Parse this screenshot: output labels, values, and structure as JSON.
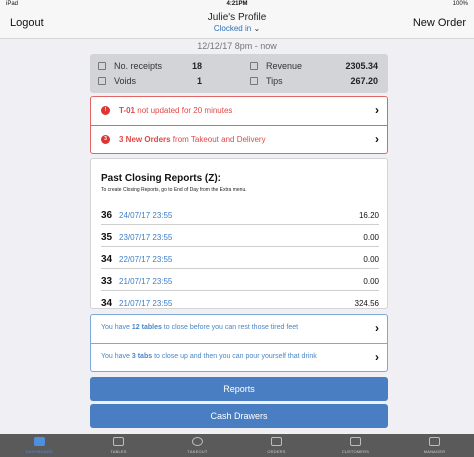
{
  "status_bar": {
    "carrier": "iPad",
    "time": "4:21PM",
    "battery": "100%"
  },
  "header": {
    "left_button": "Logout",
    "title": "Julie's Profile",
    "subtitle": "Clocked in",
    "right_button": "New Order"
  },
  "date_range": "12/12/17 8pm - now",
  "stats": {
    "receipts_label": "No. receipts",
    "receipts_value": "18",
    "voids_label": "Voids",
    "voids_value": "1",
    "revenue_label": "Revenue",
    "revenue_value": "2305.34",
    "tips_label": "Tips",
    "tips_value": "267.20"
  },
  "alerts": [
    {
      "badge": "!",
      "bold": "T-01",
      "text": " not updated for 20 minutes"
    },
    {
      "badge": "3",
      "bold": "3 New Orders",
      "text": " from Takeout and Delivery"
    }
  ],
  "past_reports": {
    "title": "Past Closing Reports (Z):",
    "subtitle": "To create Closing Reports, go to End of Day from the Extra menu.",
    "rows": [
      {
        "num": "36",
        "date": "24/07/17 23:55",
        "amount": "16.20"
      },
      {
        "num": "35",
        "date": "23/07/17 23:55",
        "amount": "0.00"
      },
      {
        "num": "34",
        "date": "22/07/17 23:55",
        "amount": "0.00"
      },
      {
        "num": "33",
        "date": "21/07/17 23:55",
        "amount": "0.00"
      },
      {
        "num": "34",
        "date": "21/07/17 23:55",
        "amount": "324.56"
      }
    ]
  },
  "tables_messages": [
    {
      "pre": "You have ",
      "bold": "12 tables",
      "post": " to close before you can rest those tired feet"
    },
    {
      "pre": "You have ",
      "bold": "3 tabs",
      "post": " to close up and then you can pour yourself that drink"
    }
  ],
  "buttons": {
    "reports": "Reports",
    "cash_drawers": "Cash Drawers"
  },
  "tabs": [
    {
      "label": "DASHBOARD",
      "icon": "dashboard-icon"
    },
    {
      "label": "TABLES",
      "icon": "tables-icon"
    },
    {
      "label": "TAKEOUT",
      "icon": "takeout-icon"
    },
    {
      "label": "ORDERS",
      "icon": "orders-icon"
    },
    {
      "label": "CUSTOMERS",
      "icon": "customers-icon"
    },
    {
      "label": "MANAGER",
      "icon": "manager-icon"
    }
  ],
  "colors": {
    "accent": "#4a7ec2",
    "alert": "#e34848",
    "link": "#3d7ec9"
  }
}
